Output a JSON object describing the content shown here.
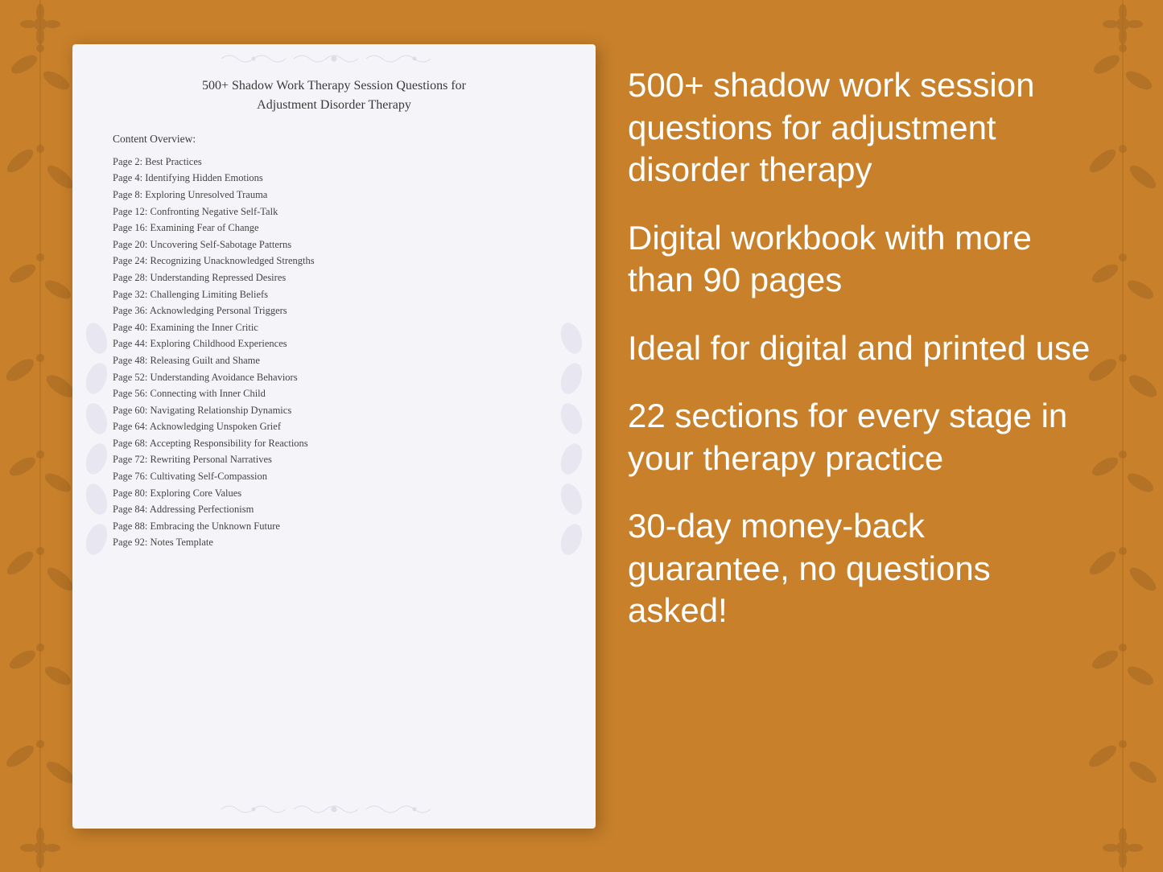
{
  "document": {
    "title_line1": "500+ Shadow Work Therapy Session Questions for",
    "title_line2": "Adjustment Disorder Therapy",
    "content_overview_label": "Content Overview:",
    "toc_items": [
      "Page  2:  Best Practices",
      "Page  4:  Identifying Hidden Emotions",
      "Page  8:  Exploring Unresolved Trauma",
      "Page 12:  Confronting Negative Self-Talk",
      "Page 16:  Examining Fear of Change",
      "Page 20:  Uncovering Self-Sabotage Patterns",
      "Page 24:  Recognizing Unacknowledged Strengths",
      "Page 28:  Understanding Repressed Desires",
      "Page 32:  Challenging Limiting Beliefs",
      "Page 36:  Acknowledging Personal Triggers",
      "Page 40:  Examining the Inner Critic",
      "Page 44:  Exploring Childhood Experiences",
      "Page 48:  Releasing Guilt and Shame",
      "Page 52:  Understanding Avoidance Behaviors",
      "Page 56:  Connecting with Inner Child",
      "Page 60:  Navigating Relationship Dynamics",
      "Page 64:  Acknowledging Unspoken Grief",
      "Page 68:  Accepting Responsibility for Reactions",
      "Page 72:  Rewriting Personal Narratives",
      "Page 76:  Cultivating Self-Compassion",
      "Page 80:  Exploring Core Values",
      "Page 84:  Addressing Perfectionism",
      "Page 88:  Embracing the Unknown Future",
      "Page 92:  Notes Template"
    ]
  },
  "features": [
    "500+ shadow work session questions for adjustment disorder therapy",
    "Digital workbook with more than 90 pages",
    "Ideal for digital and printed use",
    "22 sections for every stage in your therapy practice",
    "30-day money-back guarantee, no questions asked!"
  ],
  "decorative": {
    "floral_symbols": [
      "❧",
      "✿",
      "❧",
      "✿",
      "❧",
      "✿",
      "❧",
      "✿",
      "❧"
    ],
    "top_ornament": "✦ ✦ ✦ ✦ ✦",
    "bottom_ornament": "✦ ✦ ✦ ✦ ✦"
  }
}
